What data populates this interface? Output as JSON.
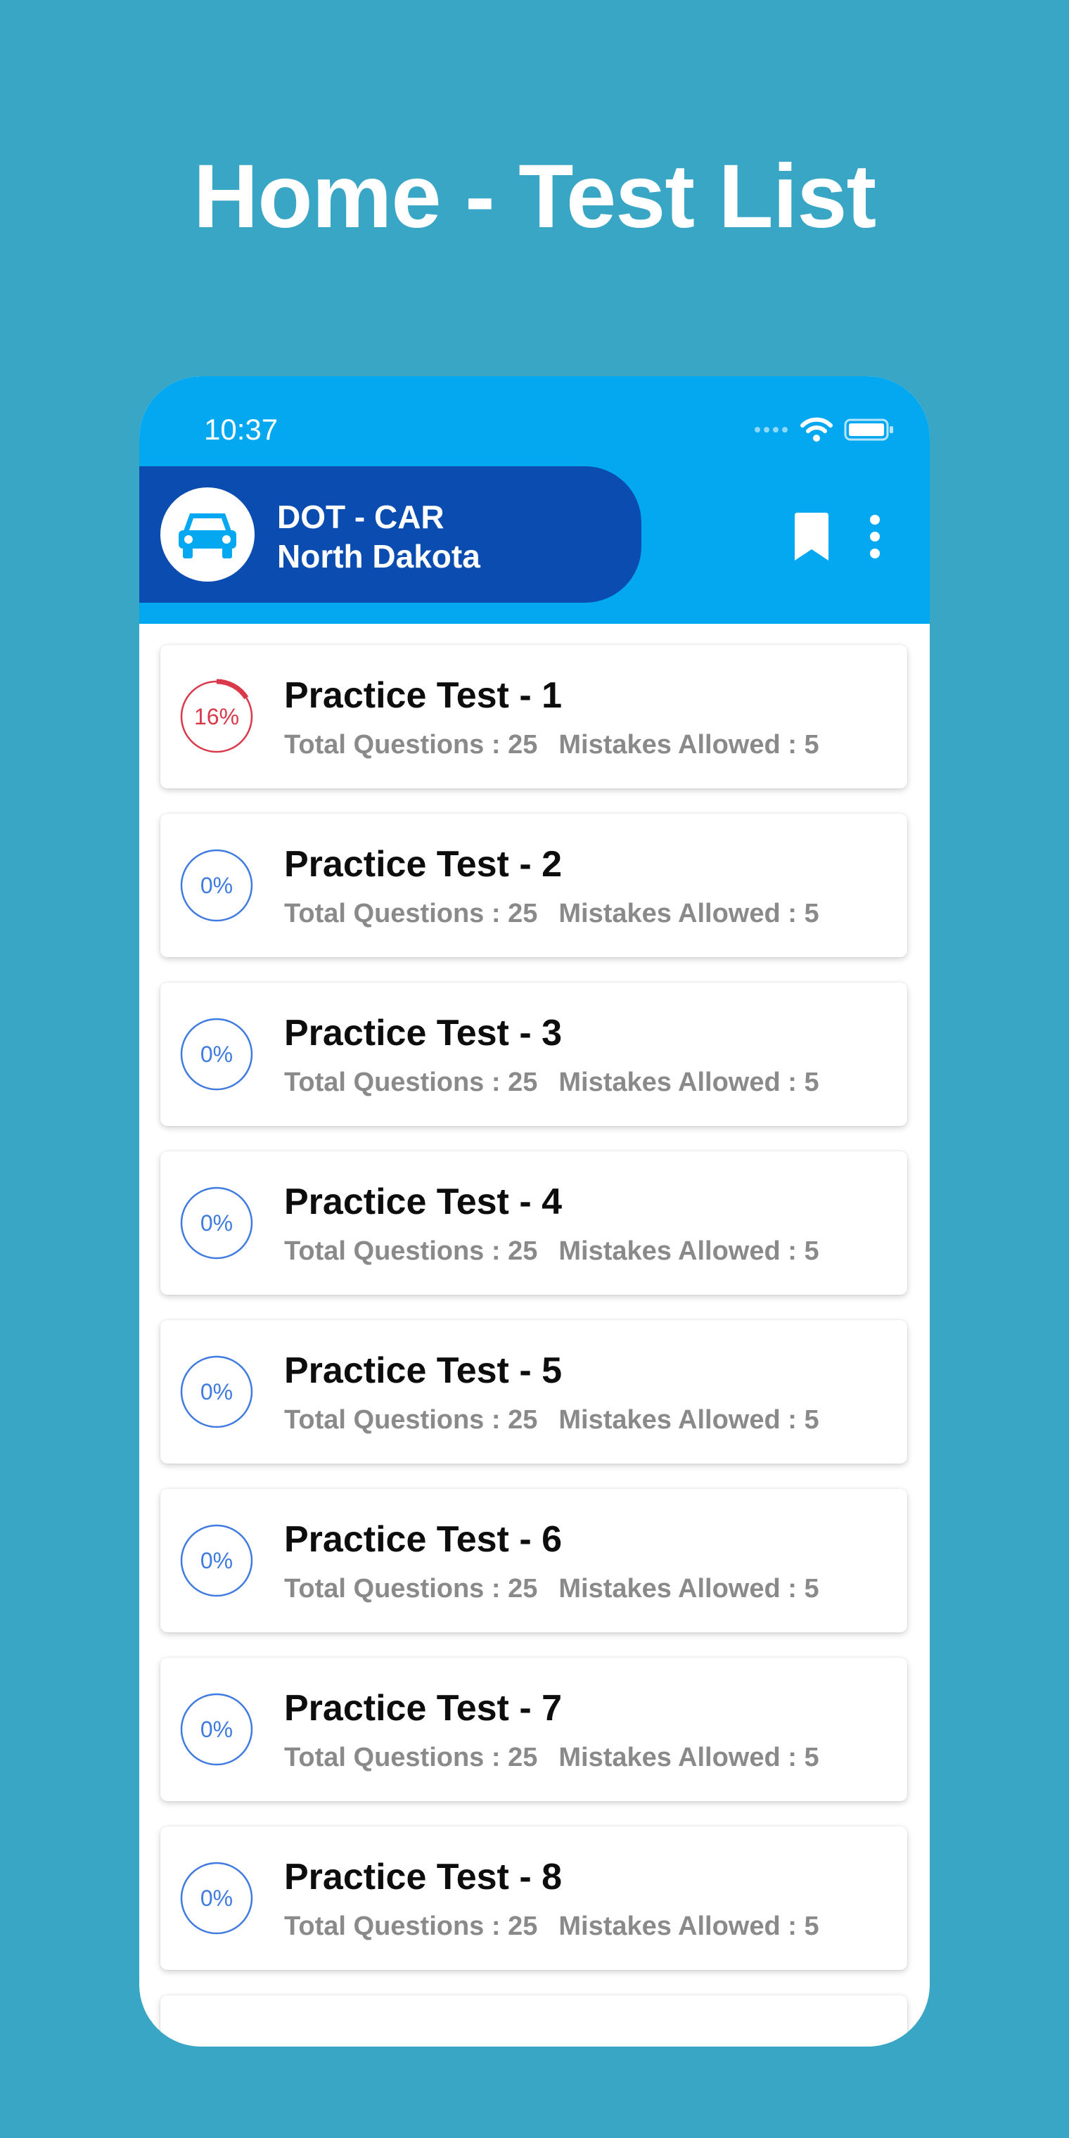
{
  "headline": "Home - Test List",
  "status_bar": {
    "time": "10:37",
    "icons": [
      "signal-dots-icon",
      "wifi-icon",
      "battery-icon"
    ]
  },
  "app_header": {
    "title_line1": "DOT - CAR",
    "title_line2": "North Dakota",
    "icons": [
      "car-icon",
      "bookmark-icon",
      "more-vertical-icon"
    ]
  },
  "colors": {
    "page_background": "#3aa6c5",
    "header_blue": "#04a8f0",
    "brand_pill": "#0a4cb0",
    "progress_started": "#d9394a",
    "progress_idle": "#3f7be0"
  },
  "tests": [
    {
      "title": "Practice Test - 1",
      "questions": "Total Questions : 25",
      "mistakes": "Mistakes Allowed : 5",
      "progress_label": "16%",
      "progress": 16
    },
    {
      "title": "Practice Test - 2",
      "questions": "Total Questions : 25",
      "mistakes": "Mistakes Allowed : 5",
      "progress_label": "0%",
      "progress": 0
    },
    {
      "title": "Practice Test - 3",
      "questions": "Total Questions : 25",
      "mistakes": "Mistakes Allowed : 5",
      "progress_label": "0%",
      "progress": 0
    },
    {
      "title": "Practice Test - 4",
      "questions": "Total Questions : 25",
      "mistakes": "Mistakes Allowed : 5",
      "progress_label": "0%",
      "progress": 0
    },
    {
      "title": "Practice Test - 5",
      "questions": "Total Questions : 25",
      "mistakes": "Mistakes Allowed : 5",
      "progress_label": "0%",
      "progress": 0
    },
    {
      "title": "Practice Test - 6",
      "questions": "Total Questions : 25",
      "mistakes": "Mistakes Allowed : 5",
      "progress_label": "0%",
      "progress": 0
    },
    {
      "title": "Practice Test - 7",
      "questions": "Total Questions : 25",
      "mistakes": "Mistakes Allowed : 5",
      "progress_label": "0%",
      "progress": 0
    },
    {
      "title": "Practice Test - 8",
      "questions": "Total Questions : 25",
      "mistakes": "Mistakes Allowed : 5",
      "progress_label": "0%",
      "progress": 0
    }
  ]
}
